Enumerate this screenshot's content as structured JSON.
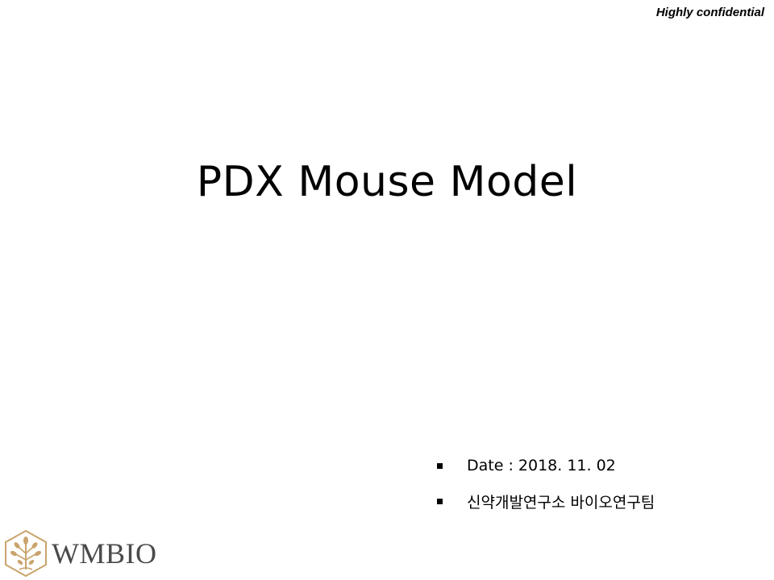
{
  "header": {
    "confidential_label": "Highly confidential"
  },
  "title": "PDX Mouse Model",
  "info": {
    "items": [
      {
        "text": "Date : 2018. 11. 02",
        "icon": "square-bullet-icon"
      },
      {
        "text": "신약개발연구소 바이오연구팀",
        "icon": "square-bullet-icon"
      }
    ]
  },
  "logo": {
    "text": "WMBIO",
    "icon": "hexagon-tree-icon",
    "mark_color": "#c9a46c",
    "text_color": "#4a4a4a"
  }
}
